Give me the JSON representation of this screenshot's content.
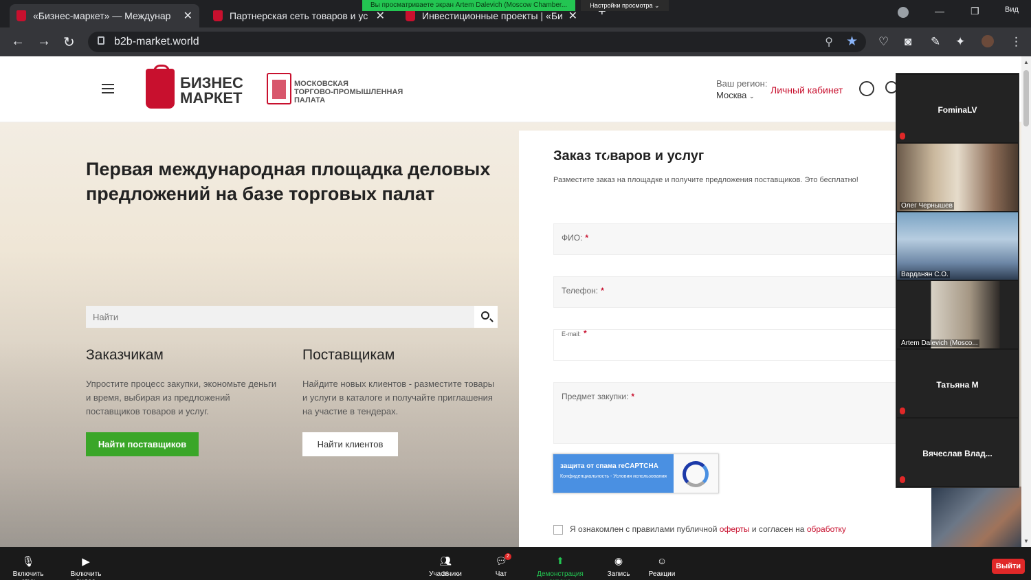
{
  "browser": {
    "tabs": [
      {
        "title": "«Бизнес-маркет» — Междунар"
      },
      {
        "title": "Партнерская сеть товаров и ус"
      },
      {
        "title": "Инвестиционные проекты | «Би"
      }
    ],
    "share_banner": "Вы просматриваете экран Artem Dalevich (Moscow Chamber...",
    "view_settings": "Настройки просмотра ⌄",
    "window_view": "Вид",
    "url": "b2b-market.world"
  },
  "site": {
    "logo_line1": "БИЗНЕС",
    "logo_line2": "МАРКЕТ",
    "mtpp_line1": "МОСКОВСКАЯ",
    "mtpp_line2": "ТОРГОВО-ПРОМЫШЛЕННАЯ",
    "mtpp_line3": "ПАЛАТА",
    "region_label": "Ваш регион:",
    "region_value": "Москва",
    "cabinet": "Личный кабинет"
  },
  "hero": {
    "title": "Первая международная площадка деловых предложений на базе торговых палат",
    "search_placeholder": "Найти",
    "customers_title": "Заказчикам",
    "customers_text": "Упростите процесс закупки, экономьте деньги и время, выбирая из предложений поставщиков товаров и услуг.",
    "customers_button": "Найти поставщиков",
    "suppliers_title": "Поставщикам",
    "suppliers_text": "Найдите новых клиентов - разместите товары и услуги в каталоге и получайте приглашения на участие в тендерах.",
    "suppliers_button": "Найти клиентов"
  },
  "order_form": {
    "title": "Заказ товаров и услуг",
    "subtitle": "Разместите заказ на площадке и получите предложения поставщиков. Это бесплатно!",
    "fields": [
      {
        "label": "ФИО:"
      },
      {
        "label": "Телефон:"
      },
      {
        "label": "E-mail:"
      },
      {
        "label": "Предмет закупки:"
      }
    ],
    "required_mark": "*",
    "captcha_line1": "защита от спама reCAPTCHA",
    "captcha_line2": "Конфиденциальность - Условия использования",
    "consent_prefix": "Я ознакомлен с правилами публичной",
    "consent_link1": "оферты",
    "consent_middle": "и согласен на",
    "consent_link2": "обработку"
  },
  "participants": [
    {
      "name": "FominaLV",
      "video": false
    },
    {
      "name": "Олег Чернышев",
      "video": true
    },
    {
      "name": "Варданян С.О.",
      "video": true
    },
    {
      "name": "Artem Dalevich (Mosco...",
      "video": true
    },
    {
      "name": "Татьяна М",
      "video": false
    },
    {
      "name": "Вячеслав Влад...",
      "video": false
    }
  ],
  "zoom_toolbar": {
    "mute": "Включить звук",
    "video": "Включить видео",
    "participants": "Участники",
    "participants_count": "36",
    "chat": "Чат",
    "chat_badge": "2",
    "share": "Демонстрация экрана",
    "record": "Запись",
    "reactions": "Реакции",
    "leave": "Выйти"
  }
}
